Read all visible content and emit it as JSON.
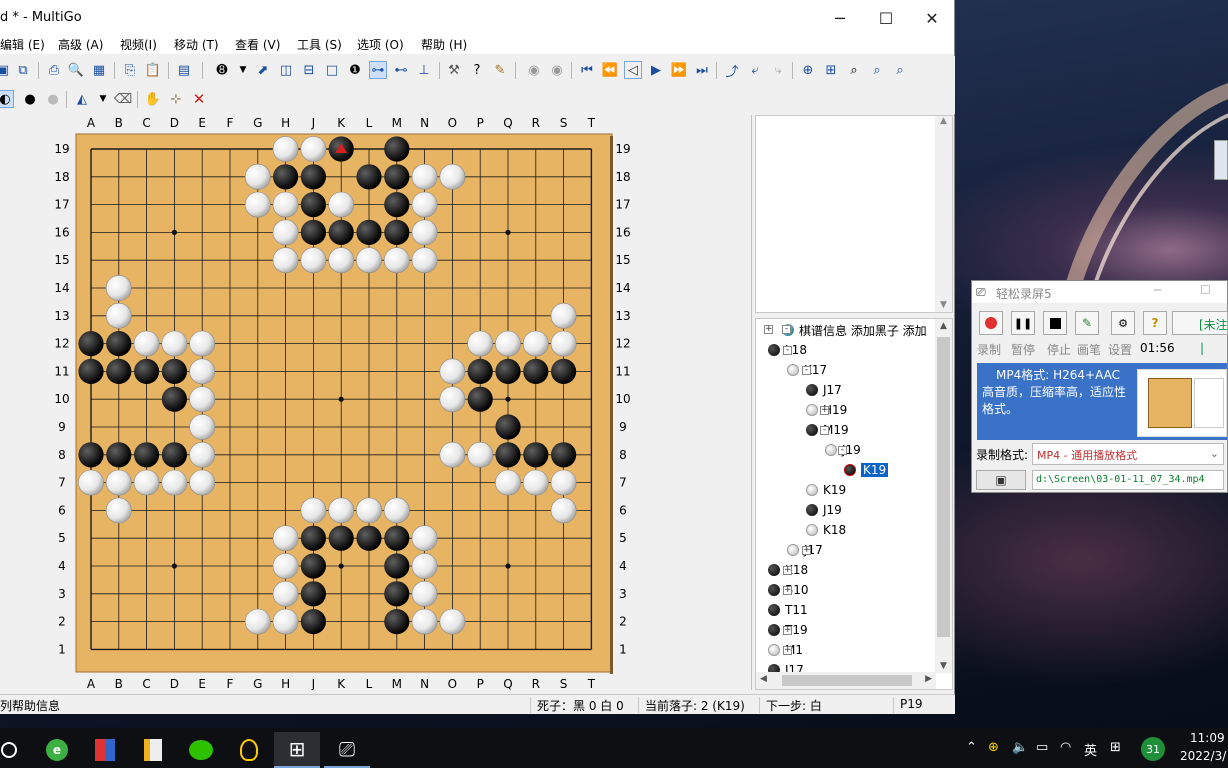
{
  "window": {
    "title": "d  * - MultiGo",
    "min_icon": "minimize-icon",
    "max_icon": "maximize-icon",
    "close_icon": "close-icon"
  },
  "menu": [
    "编辑 (E)",
    "高级 (A)",
    "视频(I)",
    "移动 (T)",
    "查看 (V)",
    "工具 (S)",
    "选项 (O)",
    "帮助 (H)"
  ],
  "board": {
    "cols": [
      "A",
      "B",
      "C",
      "D",
      "E",
      "F",
      "G",
      "H",
      "J",
      "K",
      "L",
      "M",
      "N",
      "O",
      "P",
      "Q",
      "R",
      "S",
      "T"
    ],
    "rows": [
      "19",
      "18",
      "17",
      "16",
      "15",
      "14",
      "13",
      "12",
      "11",
      "10",
      "9",
      "8",
      "7",
      "6",
      "5",
      "4",
      "3",
      "2",
      "1"
    ],
    "black": [
      "K19",
      "M19",
      "H18",
      "J18",
      "L18",
      "M18",
      "J17",
      "M17",
      "J16",
      "K16",
      "L16",
      "M16",
      "A12",
      "B12",
      "A11",
      "B11",
      "C11",
      "D11",
      "D10",
      "P11",
      "Q11",
      "R11",
      "S11",
      "P10",
      "Q9",
      "A8",
      "B8",
      "C8",
      "D8",
      "Q8",
      "R8",
      "S8",
      "J5",
      "K5",
      "L5",
      "M5",
      "J4",
      "M4",
      "J3",
      "M3",
      "J2",
      "M2"
    ],
    "white": [
      "H19",
      "J19",
      "G18",
      "N18",
      "O18",
      "G17",
      "H17",
      "K17",
      "N17",
      "H16",
      "N16",
      "H15",
      "J15",
      "K15",
      "L15",
      "M15",
      "N15",
      "B14",
      "B13",
      "S13",
      "C12",
      "D12",
      "E12",
      "P12",
      "Q12",
      "R12",
      "S12",
      "E11",
      "O11",
      "E10",
      "O10",
      "E9",
      "E8",
      "O8",
      "P8",
      "A7",
      "B7",
      "C7",
      "D7",
      "E7",
      "Q7",
      "R7",
      "S7",
      "B6",
      "S6",
      "J6",
      "K6",
      "L6",
      "M6",
      "H5",
      "N5",
      "H4",
      "N4",
      "H3",
      "N3",
      "G2",
      "H2",
      "N2",
      "O2"
    ],
    "last_move": "K19",
    "last_move_color": "#d42020"
  },
  "tree": {
    "header": "棋谱信息 添加黑子 添加",
    "nodes": [
      {
        "label": "L18",
        "color": "b"
      },
      {
        "label": "K17",
        "color": "w"
      },
      {
        "label": "J17",
        "color": "b"
      },
      {
        "label": "H19",
        "color": "w"
      },
      {
        "label": "M19",
        "color": "b"
      },
      {
        "label": "J19",
        "color": "w"
      },
      {
        "label": "K19",
        "color": "b",
        "selected": true
      },
      {
        "label": "K19",
        "color": "w"
      },
      {
        "label": "J19",
        "color": "b"
      },
      {
        "label": "K18",
        "color": "w"
      },
      {
        "label": "J17",
        "color": "w"
      },
      {
        "label": "K18",
        "color": "b"
      },
      {
        "label": "B10",
        "color": "b"
      },
      {
        "label": "T11",
        "color": "b"
      },
      {
        "label": "T19",
        "color": "b"
      },
      {
        "label": "M1",
        "color": "w"
      },
      {
        "label": "J17",
        "color": "b"
      }
    ]
  },
  "status": {
    "help": "列帮助信息",
    "captures": "死子：黑 0 白 0",
    "current": "当前落子: 2 (K19)",
    "next": "下一步: 白",
    "coord": "P19"
  },
  "recorder": {
    "title": "轻松录屏5",
    "unregistered": "[未注",
    "labels": [
      "录制",
      "暂停",
      "停止",
      "画笔",
      "设置"
    ],
    "time": "01:56",
    "info_line1": "MP4格式: H264+AAC",
    "info_line2": "高音质，压缩率高，适应性",
    "info_line3": "格式。",
    "format_label": "录制格式:",
    "format_value": "MP4 - 通用播放格式",
    "path": "d:\\Screen\\03-01-11_07_34.mp4"
  },
  "taskbar": {
    "time": "11:09",
    "date": "2022/3/",
    "ime": "英",
    "badge": "31"
  },
  "colors": {
    "board_wood": "#e7b463",
    "selection": "#0a64c8",
    "recorder_info": "#3a72c8"
  }
}
